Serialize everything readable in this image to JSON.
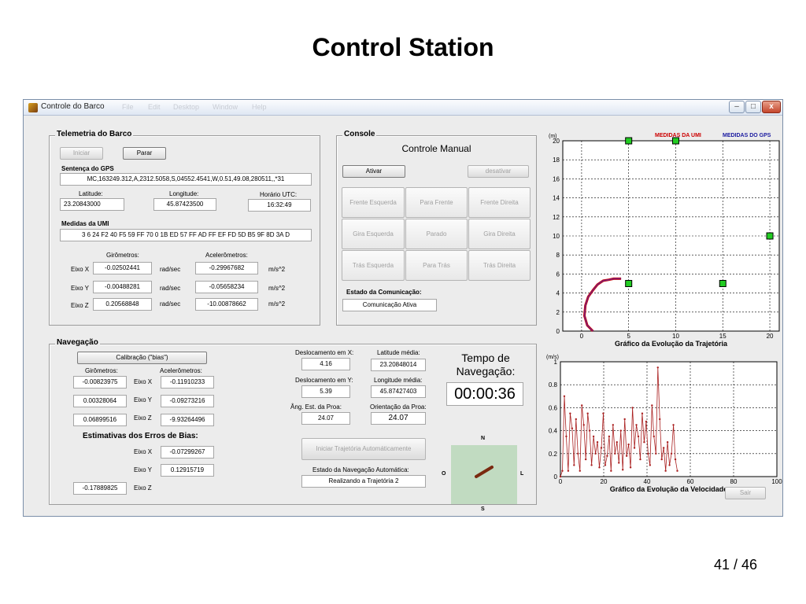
{
  "slide": {
    "title": "Control Station",
    "page": "41 / 46"
  },
  "window": {
    "title": "Controle do Barco",
    "ghost_menu": [
      "File",
      "Edit",
      "Desktop",
      "Window",
      "Help"
    ],
    "min": "–",
    "max": "□",
    "close": "x"
  },
  "telemetry": {
    "title": "Telemetria do Barco",
    "start_label": "Iniciar",
    "stop_label": "Parar",
    "gps_sentence_label": "Sentença do GPS",
    "gps_sentence": "MC,163249.312,A,2312.5058,S,04552.4541,W,0.51,49.08,280511,,*31",
    "lat_label": "Latitude:",
    "lat": "23.20843000",
    "lon_label": "Longitude:",
    "lon": "45.87423500",
    "utc_label": "Horário UTC:",
    "utc": "16:32:49",
    "umi_label": "Medidas da UMI",
    "umi": "3 6 24 F2 40 F5 59 FF 70 0 1B ED 57 FF AD FF EF FD 5D B5 9F 8D 3A D",
    "gyro_label": "Girômetros:",
    "acc_label": "Acelerômetros:",
    "rows": [
      {
        "axis": "Eixo X",
        "gyro": "-0.02502441",
        "gyro_unit": "rad/sec",
        "acc": "-0.29967682",
        "acc_unit": "m/s^2"
      },
      {
        "axis": "Eixo Y",
        "gyro": "-0.00488281",
        "gyro_unit": "rad/sec",
        "acc": "-0.05658234",
        "acc_unit": "m/s^2"
      },
      {
        "axis": "Eixo Z",
        "gyro": "0.20568848",
        "gyro_unit": "rad/sec",
        "acc": "-10.00878662",
        "acc_unit": "m/s^2"
      }
    ]
  },
  "console": {
    "title": "Console",
    "heading": "Controle Manual",
    "activate": "Ativar",
    "deactivate": "desativar",
    "buttons": [
      "Frente Esquerda",
      "Para Frente",
      "Frente Direita",
      "Gira Esquerda",
      "Parado",
      "Gira Direita",
      "Trás Esquerda",
      "Para Trás",
      "Trás Direita"
    ],
    "comm_label": "Estado da Comunicação:",
    "comm_value": "Comunicação Ativa"
  },
  "navigation": {
    "title": "Navegação",
    "calib": "Calibração (\"bias\")",
    "gyro_label": "Girômetros:",
    "acc_label": "Acelerômetros:",
    "rows": [
      {
        "gyro": "-0.00823975",
        "axis": "Eixo X",
        "acc": "-0.11910233"
      },
      {
        "gyro": "0.00328064",
        "axis": "Eixo Y",
        "acc": "-0.09273216"
      },
      {
        "gyro": "0.06899516",
        "axis": "Eixo Z",
        "acc": "-9.93264496"
      }
    ],
    "bias_title": "Estimativas dos Erros de Bias:",
    "bias_x_label": "Eixo X",
    "bias_x": "-0.07299267",
    "bias_y_label": "Eixo Y",
    "bias_y": "0.12915719",
    "bias_z_label": "Eixo Z",
    "bias_z": "-0.17889825",
    "disp_x_label": "Deslocamento em X:",
    "disp_x": "4.16",
    "lat_avg_label": "Latitude média:",
    "lat_avg": "23.20848014",
    "disp_y_label": "Deslocamento em Y:",
    "disp_y": "5.39",
    "lon_avg_label": "Longitude média:",
    "lon_avg": "45.87427403",
    "heading_est_label": "Âng. Est. da Proa:",
    "heading_est": "24.07",
    "heading_label": "Orientação da Proa:",
    "heading": "24.07",
    "auto_btn": "Iniciar Trajetória Automáticamente",
    "auto_state_label": "Estado da Navegação Automática:",
    "auto_state": "Realizando a Trajetória 2",
    "time_label_1": "Tempo de",
    "time_label_2": "Navegação:",
    "time": "00:00:36",
    "compass": {
      "n": "N",
      "s": "S",
      "o": "O",
      "l": "L"
    }
  },
  "exit_label": "Sair",
  "colors": {
    "umi": "#cc0000",
    "gps": "#1a1aa0",
    "traj": "#7a1f7a",
    "gps_marker": "#22cc22",
    "speed": "#aa2020",
    "timer": "#0000cc"
  },
  "chart_data": [
    {
      "type": "scatter",
      "title": "Gráfico da Evolução da Trajetória",
      "xlabel": "(m)",
      "ylabel": "(m)",
      "xlim": [
        -2,
        21
      ],
      "ylim": [
        0,
        20
      ],
      "xticks": [
        0,
        5,
        10,
        15,
        20
      ],
      "yticks": [
        0,
        2,
        4,
        6,
        8,
        10,
        12,
        14,
        16,
        18,
        20
      ],
      "grid": true,
      "legend": [
        "MEDIDAS DA UMI",
        "MEDIDAS DO GPS"
      ],
      "series": [
        {
          "name": "MEDIDAS DA UMI",
          "x": [
            1.2,
            0.6,
            0.3,
            0.4,
            0.7,
            1.2,
            1.7,
            2.3,
            2.9,
            3.4,
            4.2
          ],
          "y": [
            0,
            0.6,
            1.6,
            2.7,
            3.6,
            4.3,
            4.9,
            5.3,
            5.4,
            5.5,
            5.5
          ]
        },
        {
          "name": "MEDIDAS DO GPS",
          "x": [
            5,
            10,
            20,
            5,
            15
          ],
          "y": [
            20,
            20,
            10,
            5,
            5
          ]
        }
      ]
    },
    {
      "type": "line",
      "title": "Gráfico da Evolução da Velocidade",
      "xlabel": "(s)",
      "ylabel": "(m/s)",
      "xlim": [
        0,
        100
      ],
      "ylim": [
        0,
        1
      ],
      "xticks": [
        0,
        20,
        40,
        60,
        80,
        100
      ],
      "yticks": [
        0,
        0.2,
        0.4,
        0.6,
        0.8,
        1
      ],
      "grid": true,
      "series": [
        {
          "name": "",
          "x": [
            0,
            0.9,
            1.8,
            2.7,
            3.6,
            4.5,
            5.4,
            6.3,
            7.2,
            8.1,
            9,
            9.9,
            10.8,
            11.7,
            12.6,
            13.5,
            14.4,
            15.3,
            16.2,
            17.1,
            18,
            18.9,
            19.8,
            20.7,
            21.6,
            22.5,
            23.4,
            24.3,
            25.2,
            26.1,
            27,
            27.9,
            28.8,
            29.7,
            30.6,
            31.5,
            32.4,
            33.3,
            34.2,
            35.1,
            36,
            36.9,
            37.8,
            38.7,
            39.6,
            40.5,
            41.4,
            42.3,
            43.2,
            44.1,
            45,
            45.9,
            46.8,
            47.7,
            48.6,
            49.5,
            50.4,
            51.3,
            52.2,
            53.1,
            54
          ],
          "y": [
            0,
            0.05,
            0.7,
            0.35,
            0.05,
            0.55,
            0.42,
            0.1,
            0.5,
            0.2,
            0.05,
            0.62,
            0.45,
            0.15,
            0.55,
            0.4,
            0.1,
            0.35,
            0.2,
            0.3,
            0.08,
            0.25,
            0.55,
            0.1,
            0.18,
            0.35,
            0.05,
            0.45,
            0.2,
            0.3,
            0.12,
            0.4,
            0.06,
            0.5,
            0.18,
            0.28,
            0.08,
            0.6,
            0.25,
            0.45,
            0.35,
            0.15,
            0.55,
            0.3,
            0.48,
            0.2,
            0.1,
            0.62,
            0.35,
            0.2,
            0.95,
            0.5,
            0.15,
            0.25,
            0.05,
            0.3,
            0.1,
            0.2,
            0.45,
            0.15,
            0.05
          ]
        }
      ]
    }
  ]
}
